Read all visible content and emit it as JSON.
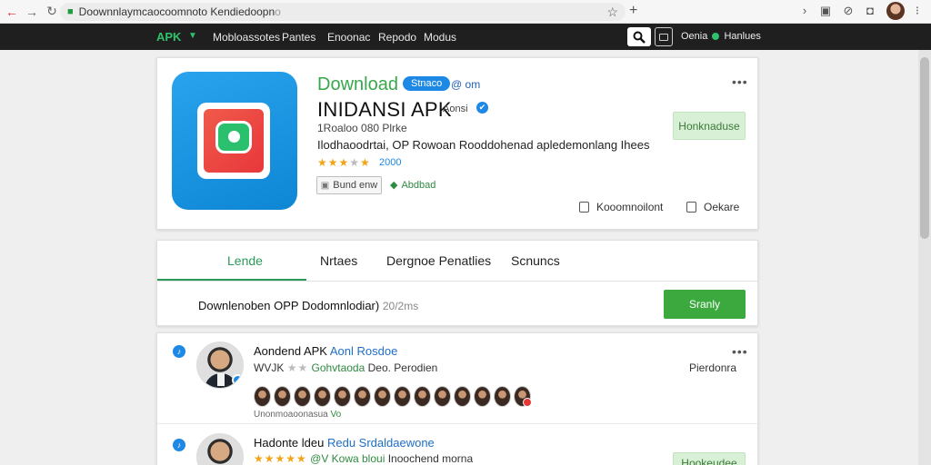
{
  "browser": {
    "url": "Doownnlaymcaocoomnoto Kendiedoopn",
    "url_dim": "o",
    "icons": [
      "back-icon",
      "forward-icon",
      "reload-icon",
      "lock-icon",
      "star-icon",
      "new-tab-icon",
      "chevron-right-icon",
      "extension-icon",
      "settings-icon",
      "shield-icon",
      "menu-dots-icon"
    ]
  },
  "topbar": {
    "brand": "APK",
    "menu": [
      "Mobloassotes",
      "Pantes",
      "Enoonac",
      "Repodo",
      "Modus"
    ],
    "right_text_a": "Oenia",
    "right_text_b": "Hanlues",
    "accent": "#2ec36a"
  },
  "hero": {
    "download_label": "Download",
    "badge": "Stnaco",
    "version": "@ om",
    "title": "INIDANSI APK",
    "developer": "Aonsi",
    "meta": "1Roaloo 080 Plrke",
    "description": "Ilodhaoodrtai, OP Rowoan Rooddohenad apledemonlang Ihees",
    "rating_value": 0.75,
    "rating_text": "2000",
    "tag_button": "Bund enw",
    "install_link": "Abdbad",
    "download_button": "Honknaduse",
    "action_a": "Kooomnoilont",
    "action_b": "Oekare"
  },
  "tabs": {
    "items": [
      "Lende",
      "Nrtaes",
      "Dergnoe Penatlies",
      "Scnuncs"
    ],
    "active_index": 0,
    "row_text": "Downlenoben OPP Dodomnlodiar)",
    "row_count": "20/2ms",
    "sort_button": "Sranly"
  },
  "list": {
    "items": [
      {
        "title": "Aondend APK",
        "title_blue": "Aonl Rosdoe",
        "sub_a": "WVJK",
        "sub_stars": "★★",
        "sub_b": "Gohvtaoda",
        "sub_c": "Deo. Perodien",
        "right": "Pierdonra",
        "foot": "Unonmoaoonasua",
        "foot_g": "Vo"
      },
      {
        "title": "Hadonte ldeu",
        "title_blue": "Redu Srdaldaewone",
        "sub_stars": "★★★★★",
        "sub_a": "@V Kowa bloui",
        "sub_c": "Inoochend morna",
        "button": "Hookeudee"
      }
    ]
  },
  "colors": {
    "green": "#3ba93e",
    "blue": "#1e88e5",
    "star": "#f0a416",
    "dark_bar": "#1f1f1f"
  }
}
